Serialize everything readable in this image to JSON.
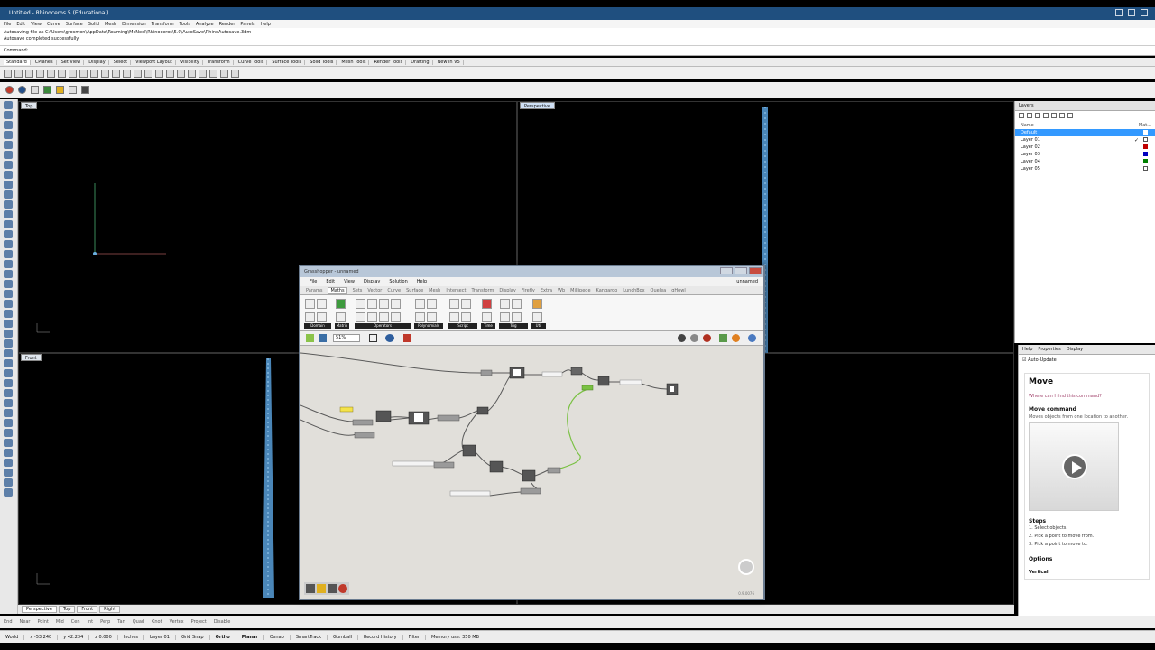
{
  "window": {
    "title": "Untitled - Rhinoceros 5 (Educational)"
  },
  "menu": [
    "File",
    "Edit",
    "View",
    "Curve",
    "Surface",
    "Solid",
    "Mesh",
    "Dimension",
    "Transform",
    "Tools",
    "Analyze",
    "Render",
    "Panels",
    "Help"
  ],
  "history": {
    "line1": "Autosaving file as C:\\Users\\grosmon\\AppData\\Roaming\\McNeel\\Rhinoceros\\5.0\\AutoSave\\RhinoAutosave.3dm",
    "line2": "Autosave completed successfully"
  },
  "command": {
    "label": "Command:"
  },
  "toolbar_tabs": [
    "Standard",
    "CPlanes",
    "Set View",
    "Display",
    "Select",
    "Viewport Layout",
    "Visibility",
    "Transform",
    "Curve Tools",
    "Surface Tools",
    "Solid Tools",
    "Mesh Tools",
    "Render Tools",
    "Drafting",
    "New in V5"
  ],
  "viewports": {
    "top": "Top",
    "perspective": "Perspective",
    "front": "Front"
  },
  "viewport_tabs": [
    "Perspective",
    "Top",
    "Front",
    "Right"
  ],
  "osnap": [
    "End",
    "Near",
    "Point",
    "Mid",
    "Cen",
    "Int",
    "Perp",
    "Tan",
    "Quad",
    "Knot",
    "Vertex",
    "Project",
    "Disable"
  ],
  "status": {
    "cplane": "World",
    "x": "x -53.240",
    "y": "y 42.234",
    "z": "z 0.000",
    "units": "Inches",
    "layer": "Layer 01",
    "grid_snap": "Grid Snap",
    "ortho": "Ortho",
    "planar": "Planar",
    "osnap": "Osnap",
    "smarttrack": "SmartTrack",
    "gumball": "Gumball",
    "record_history": "Record History",
    "filter": "Filter",
    "memory": "Memory use: 350 MB"
  },
  "layers": {
    "title": "Layers",
    "col_name": "Name",
    "col_mat": "Mat...",
    "rows": [
      {
        "name": "Default",
        "color": "#ffffff"
      },
      {
        "name": "Layer 01",
        "color": "#ffffff"
      },
      {
        "name": "Layer 02",
        "color": "#c00000"
      },
      {
        "name": "Layer 03",
        "color": "#0000c0"
      },
      {
        "name": "Layer 04",
        "color": "#008000"
      },
      {
        "name": "Layer 05",
        "color": "#ffffff"
      }
    ]
  },
  "help": {
    "tabs": [
      "Help",
      "Properties",
      "Display"
    ],
    "auto_update": "Auto-Update",
    "command": "Move",
    "where": "Where can I find this command?",
    "heading": "Move command",
    "description": "Moves objects from one location to another.",
    "steps_label": "Steps",
    "steps": [
      "1.  Select objects.",
      "2.  Pick a point to move from.",
      "3.  Pick a point to move to."
    ],
    "options_label": "Options",
    "vertical_label": "Vertical"
  },
  "grasshopper": {
    "title": "Grasshopper - unnamed",
    "menu": [
      "File",
      "Edit",
      "View",
      "Display",
      "Solution",
      "Help"
    ],
    "doc_name": "unnamed",
    "tabs": [
      "Params",
      "Maths",
      "Sets",
      "Vector",
      "Curve",
      "Surface",
      "Mesh",
      "Intersect",
      "Transform",
      "Display",
      "Firefly",
      "Extra",
      "Wb",
      "Millipede",
      "Kangaroo",
      "LunchBox",
      "Quelea",
      "gHowl"
    ],
    "active_tab": "Maths",
    "groups": [
      "Domain",
      "Matrix",
      "Operators",
      "Polynomials",
      "Script",
      "Time",
      "Trig",
      "Util"
    ],
    "zoom": "51%",
    "version": "0.9.0076"
  },
  "colors": {
    "rhino_title": "#1f4f7f",
    "gh_canvas": "#e1dfda",
    "layer_selected": "#3399ff",
    "wire_selected": "#7ac143"
  }
}
